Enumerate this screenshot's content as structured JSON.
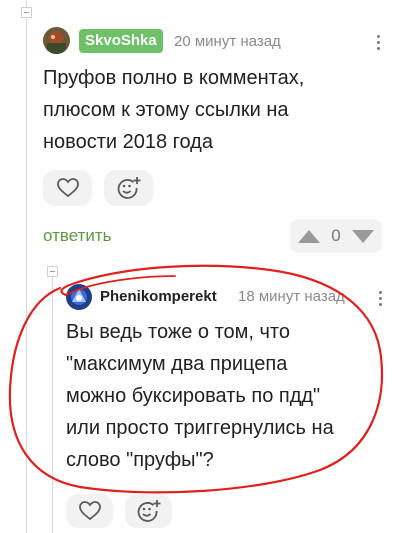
{
  "colors": {
    "accent_green": "#5b9a3e",
    "badge_green": "#6ec069",
    "annotation_red": "#e0201c"
  },
  "comment_1": {
    "author": "SkvoShka",
    "time": "20 минут назад",
    "text_lines": [
      "Пруфов полно в комментах,",
      "плюсом к этому ссылки на",
      "новости 2018 года"
    ],
    "reply_label": "ответить",
    "vote_count": "0",
    "icons": [
      "heart-icon",
      "add-emoji-icon",
      "upvote-icon",
      "downvote-icon",
      "more-options-icon"
    ]
  },
  "comment_2": {
    "author": "Phenikomperekt",
    "time": "18 минут назад",
    "text_lines": [
      "Вы ведь тоже о том, что",
      "\"максимум два прицепа",
      "можно буксировать по пдд\"",
      "или просто триггернулись на",
      "слово \"пруфы\"?"
    ],
    "icons": [
      "heart-icon",
      "add-emoji-icon",
      "more-options-icon"
    ]
  }
}
